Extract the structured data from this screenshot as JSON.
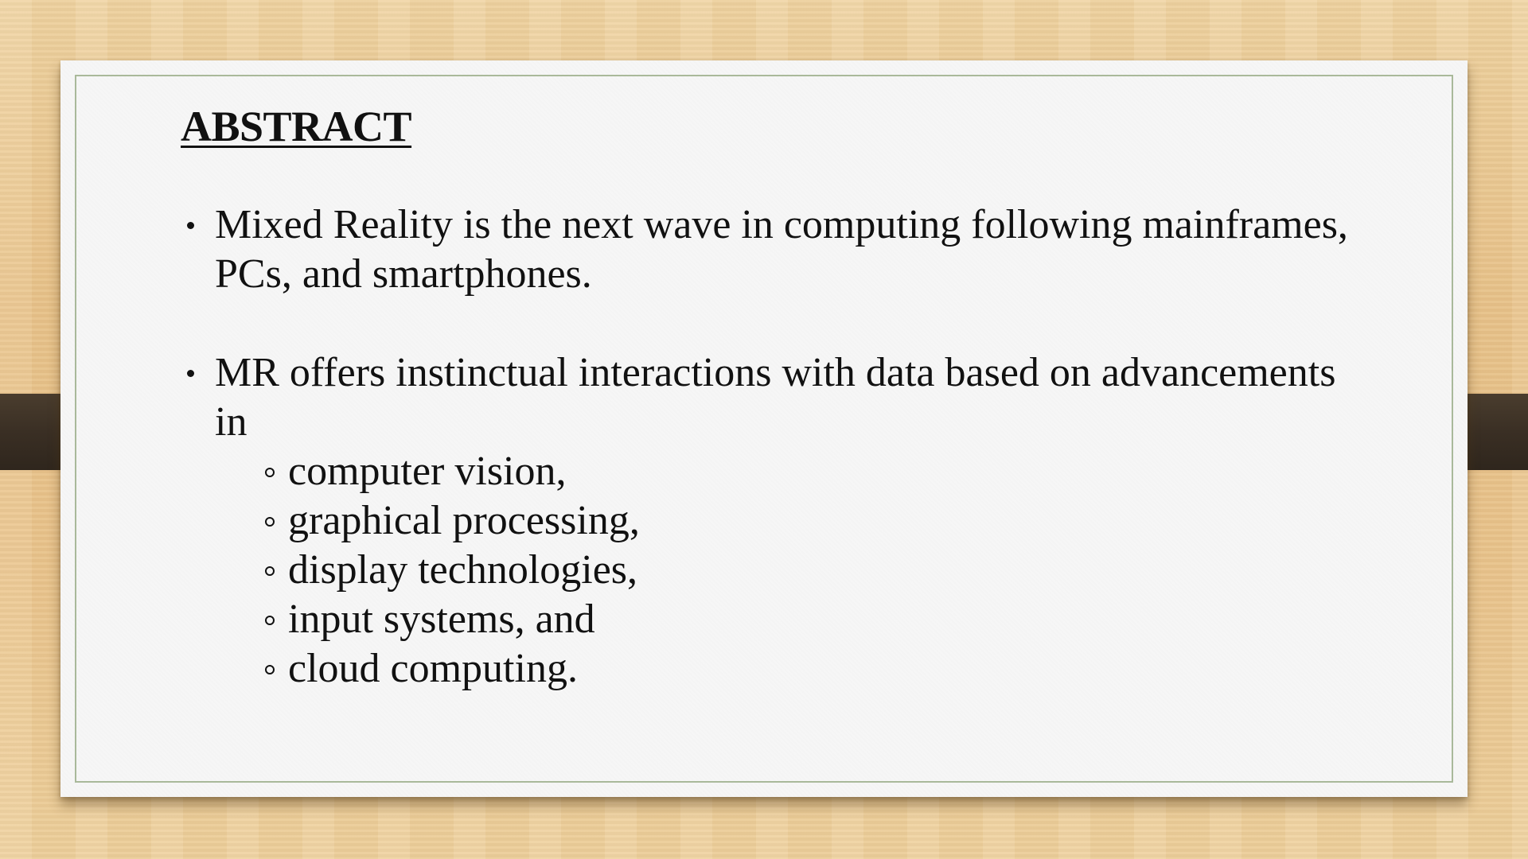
{
  "slide": {
    "title": "ABSTRACT",
    "bullets": [
      {
        "text": "Mixed Reality is the next wave in computing following mainframes, PCs, and smartphones."
      },
      {
        "text": "MR offers instinctual interactions with data based on advancements in",
        "sub_items": [
          "computer vision,",
          "graphical processing,",
          "display technologies,",
          "input systems, and",
          "cloud computing."
        ]
      }
    ]
  },
  "colors": {
    "card_background": "#f6f6f6",
    "card_border": "#a9b99a",
    "wood_background": "#ebc68f",
    "strap": "#3a2f24",
    "text": "#111111"
  }
}
